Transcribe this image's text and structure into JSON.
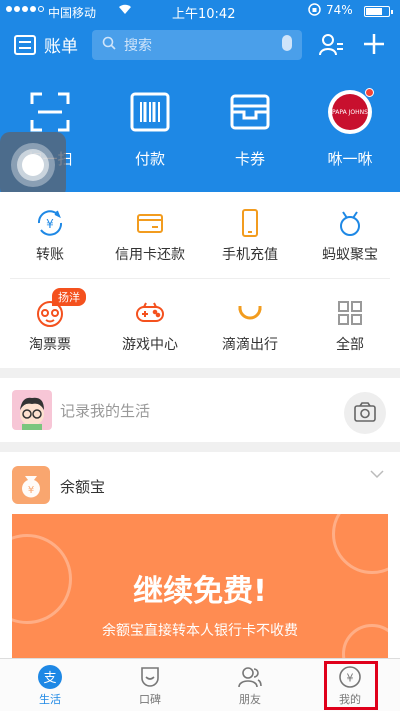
{
  "status_bar": {
    "carrier": "中国移动",
    "time": "上午10:42",
    "battery": "74%",
    "battery_level": 0.74
  },
  "header": {
    "bill_label": "账单",
    "search_placeholder": "搜索"
  },
  "top_functions": [
    {
      "label": "扫一扫",
      "icon": "scan-icon"
    },
    {
      "label": "付款",
      "icon": "barcode-icon"
    },
    {
      "label": "卡券",
      "icon": "card-wallet-icon"
    },
    {
      "label": "咻一咻",
      "icon": "papa-johns-logo"
    }
  ],
  "papa_logo_text": "PAPA JOHNS",
  "grid_row1": [
    {
      "label": "转账",
      "icon": "transfer-icon"
    },
    {
      "label": "信用卡还款",
      "icon": "credit-card-icon"
    },
    {
      "label": "手机充值",
      "icon": "phone-icon"
    },
    {
      "label": "蚂蚁聚宝",
      "icon": "ant-fortune-icon"
    }
  ],
  "grid_row2": [
    {
      "label": "淘票票",
      "icon": "ticket-face-icon",
      "badge": "扬洋"
    },
    {
      "label": "游戏中心",
      "icon": "gamepad-icon"
    },
    {
      "label": "滴滴出行",
      "icon": "didi-icon"
    },
    {
      "label": "全部",
      "icon": "grid-all-icon"
    }
  ],
  "life": {
    "placeholder": "记录我的生活"
  },
  "yuebao": {
    "title": "余额宝",
    "headline": "继续免费!",
    "subtext": "余额宝直接转本人银行卡不收费"
  },
  "tabs": [
    {
      "label": "生活",
      "icon": "alipay-icon",
      "active": true
    },
    {
      "label": "口碑",
      "icon": "koubei-icon",
      "active": false
    },
    {
      "label": "朋友",
      "icon": "friends-icon",
      "active": false
    },
    {
      "label": "我的",
      "icon": "mine-yen-icon",
      "active": false
    }
  ],
  "colors": {
    "primary": "#1e88e5",
    "orange": "#ff8c52",
    "red_highlight": "#e0001b"
  }
}
